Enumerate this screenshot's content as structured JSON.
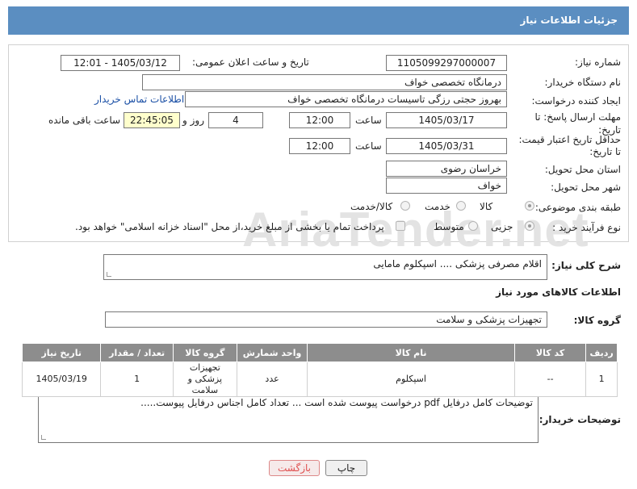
{
  "header": {
    "title": "جزئیات اطلاعات نیاز"
  },
  "form": {
    "need_number_label": "شماره نیاز:",
    "need_number": "1105099297000007",
    "announce_label": "تاریخ و ساعت اعلان عمومی:",
    "announce_value": "1405/03/12 - 12:01",
    "buyer_label": "نام دستگاه خریدار:",
    "buyer_value": "درمانگاه تخصصی خواف",
    "requester_label": "ایجاد کننده درخواست:",
    "requester_value": "بهروز حجتی رزگی تاسیسات درمانگاه تخصصی خواف",
    "contact_link": "اطلاعات تماس خریدار",
    "deadline_label": "مهلت ارسال پاسخ: تا تاریخ:",
    "deadline_date": "1405/03/17",
    "time_label": "ساعت",
    "deadline_time": "12:00",
    "days_value": "4",
    "days_label": "روز و",
    "remaining_time": "22:45:05",
    "remaining_label": "ساعت باقی مانده",
    "validity_label": "حداقل تاریخ اعتبار قیمت: تا تاریخ:",
    "validity_date": "1405/03/31",
    "validity_time": "12:00",
    "province_label": "استان محل تحویل:",
    "province_value": "خراسان رضوی",
    "city_label": "شهر محل تحویل:",
    "city_value": "خواف",
    "category_label": "طبقه بندی موضوعی:",
    "category_options": [
      "کالا",
      "خدمت",
      "کالا/خدمت"
    ],
    "category_selected": "کالا",
    "process_label": "نوع فرآیند خرید :",
    "process_options": [
      "جزیی",
      "متوسط"
    ],
    "process_selected": "جزیی",
    "payment_note": "پرداخت تمام یا بخشی از مبلغ خرید،از محل \"اسناد خزانه اسلامی\" خواهد بود."
  },
  "summary": {
    "label": "شرح کلی نیاز:",
    "value": "اقلام مصرفی پزشکی      ....    اسپکلوم مامایی"
  },
  "goods_info_title": "اطلاعات کالاهای مورد نیاز",
  "goods_group": {
    "label": "گروه کالا:",
    "value": "تجهیزات پزشکی و سلامت"
  },
  "table": {
    "headers": [
      "ردیف",
      "کد کالا",
      "نام کالا",
      "واحد شمارش",
      "گروه کالا",
      "تعداد / مقدار",
      "تاریخ نیاز"
    ],
    "rows": [
      [
        "1",
        "--",
        "اسپکلوم",
        "عدد",
        "تجهیزات پزشکی و سلامت",
        "1",
        "1405/03/19"
      ]
    ]
  },
  "buyer_notes": {
    "label": "توضیحات خریدار:",
    "value": "توضیحات کامل درفایل pdf درخواست پیوست شده است ...  تعداد کامل اجناس درفایل پیوست....."
  },
  "buttons": {
    "print": "چاپ",
    "back": "بازگشت"
  },
  "watermark": "AriaTender.net"
}
